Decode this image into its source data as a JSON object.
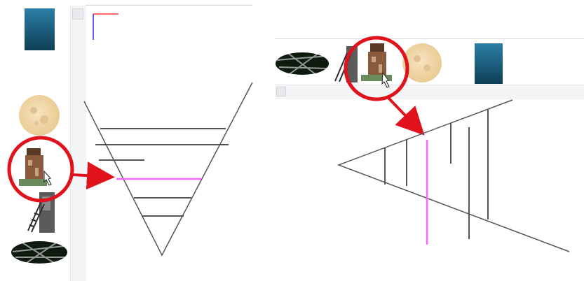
{
  "left_panel": {
    "stack_items": [
      "square-gradient-tile",
      "moon-tile",
      "tower-tile",
      "ladder-tile",
      "palm-tile"
    ],
    "selected_item": "tower-tile"
  },
  "right_panel": {
    "row_items": [
      "palm-tile",
      "ladder-tile",
      "tower-tile",
      "moon-tile",
      "square-gradient-tile"
    ],
    "selected_item": "tower-tile"
  },
  "colors": {
    "highlight_circle": "#e0121b",
    "arrow": "#e0121b",
    "selected_line": "#ff66ff",
    "guide_line": "#555555",
    "tile_blue_top": "#2a7fa6",
    "tile_blue_bottom": "#0f3f56",
    "moon": "#f1d7a8"
  }
}
